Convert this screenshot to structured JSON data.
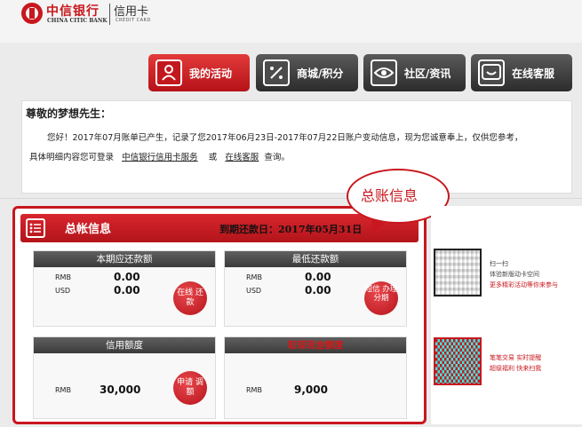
{
  "brand": {
    "bank_cn": "中信银行",
    "bank_en": "CHINA CITIC BANK",
    "card_cn": "信用卡",
    "card_en": "CREDIT CARD"
  },
  "nav": {
    "tabs": [
      {
        "label": "我的活动",
        "icon": "user-icon",
        "active": true
      },
      {
        "label": "商城/积分",
        "icon": "percent-icon",
        "active": false
      },
      {
        "label": "社区/资讯",
        "icon": "eye-icon",
        "active": false
      },
      {
        "label": "在线客服",
        "icon": "chat-smile-icon",
        "active": false
      }
    ]
  },
  "greeting": {
    "name": "尊敬的梦想先生：",
    "line1": "您好！2017年07月账单已产生，记录了您2017年06月23日-2017年07月22日账户变动信息，现为您诚意奉上，仅供您参考，",
    "line2_prefix": "具体明细内容您可登录",
    "link1": "中信银行信用卡服务",
    "or": "或",
    "link2": "在线客服",
    "line2_suffix": "查询。"
  },
  "callout": {
    "text": "总账信息"
  },
  "summary": {
    "title": "总帐信息",
    "due_date": "到期还款日：2017年05月31日",
    "cards": {
      "current_due": {
        "title": "本期应还款额",
        "rmb_label": "RMB",
        "rmb_value": "0.00",
        "usd_label": "USD",
        "usd_value": "0.00",
        "button": "在线 还款"
      },
      "min_due": {
        "title": "最低还款额",
        "rmb_label": "RMB",
        "rmb_value": "0.00",
        "usd_label": "USD",
        "usd_value": "0.00",
        "button": "短信 办理 分期"
      },
      "credit_limit": {
        "title": "信用额度",
        "rmb_label": "RMB",
        "rmb_value": "30,000",
        "button": "申请 调额"
      },
      "cash_limit": {
        "title": "取现现金额度",
        "rmb_label": "RMB",
        "rmb_value": "9,000"
      }
    }
  },
  "side": {
    "qr1_line1": "扫一扫",
    "qr1_line2": "体验新版动卡空间",
    "qr1_line3": "更多精彩活动等你来参与",
    "qr2_line1": "笔笔交易 实时提醒",
    "qr2_line2": "超级福利 快来扫我"
  },
  "colors": {
    "brand_red": "#c8171e",
    "tab_dark": "#3a3a3a"
  }
}
